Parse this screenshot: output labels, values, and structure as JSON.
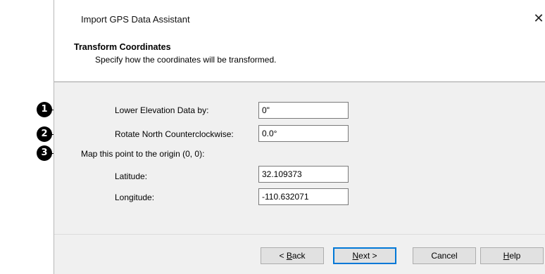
{
  "window": {
    "title": "Import GPS Data Assistant",
    "close_glyph": "✕"
  },
  "header": {
    "title": "Transform Coordinates",
    "subtitle": "Specify how the coordinates will be transformed."
  },
  "form": {
    "lower_elevation_label": "Lower Elevation Data by:",
    "lower_elevation_value": "0\"",
    "rotate_north_label": "Rotate North Counterclockwise:",
    "rotate_north_value": "0.0°",
    "map_point_label": "Map this point to the origin (0, 0):",
    "latitude_label": "Latitude:",
    "latitude_value": "32.109373",
    "longitude_label": "Longitude:",
    "longitude_value": "-110.632071"
  },
  "buttons": {
    "back": {
      "label_prefix": "< ",
      "mnemonic": "B",
      "rest": "ack"
    },
    "next": {
      "mnemonic": "N",
      "rest": "ext >"
    },
    "cancel": "Cancel",
    "help": {
      "mnemonic": "H",
      "rest": "elp"
    }
  },
  "callouts": [
    "1",
    "2",
    "3"
  ]
}
